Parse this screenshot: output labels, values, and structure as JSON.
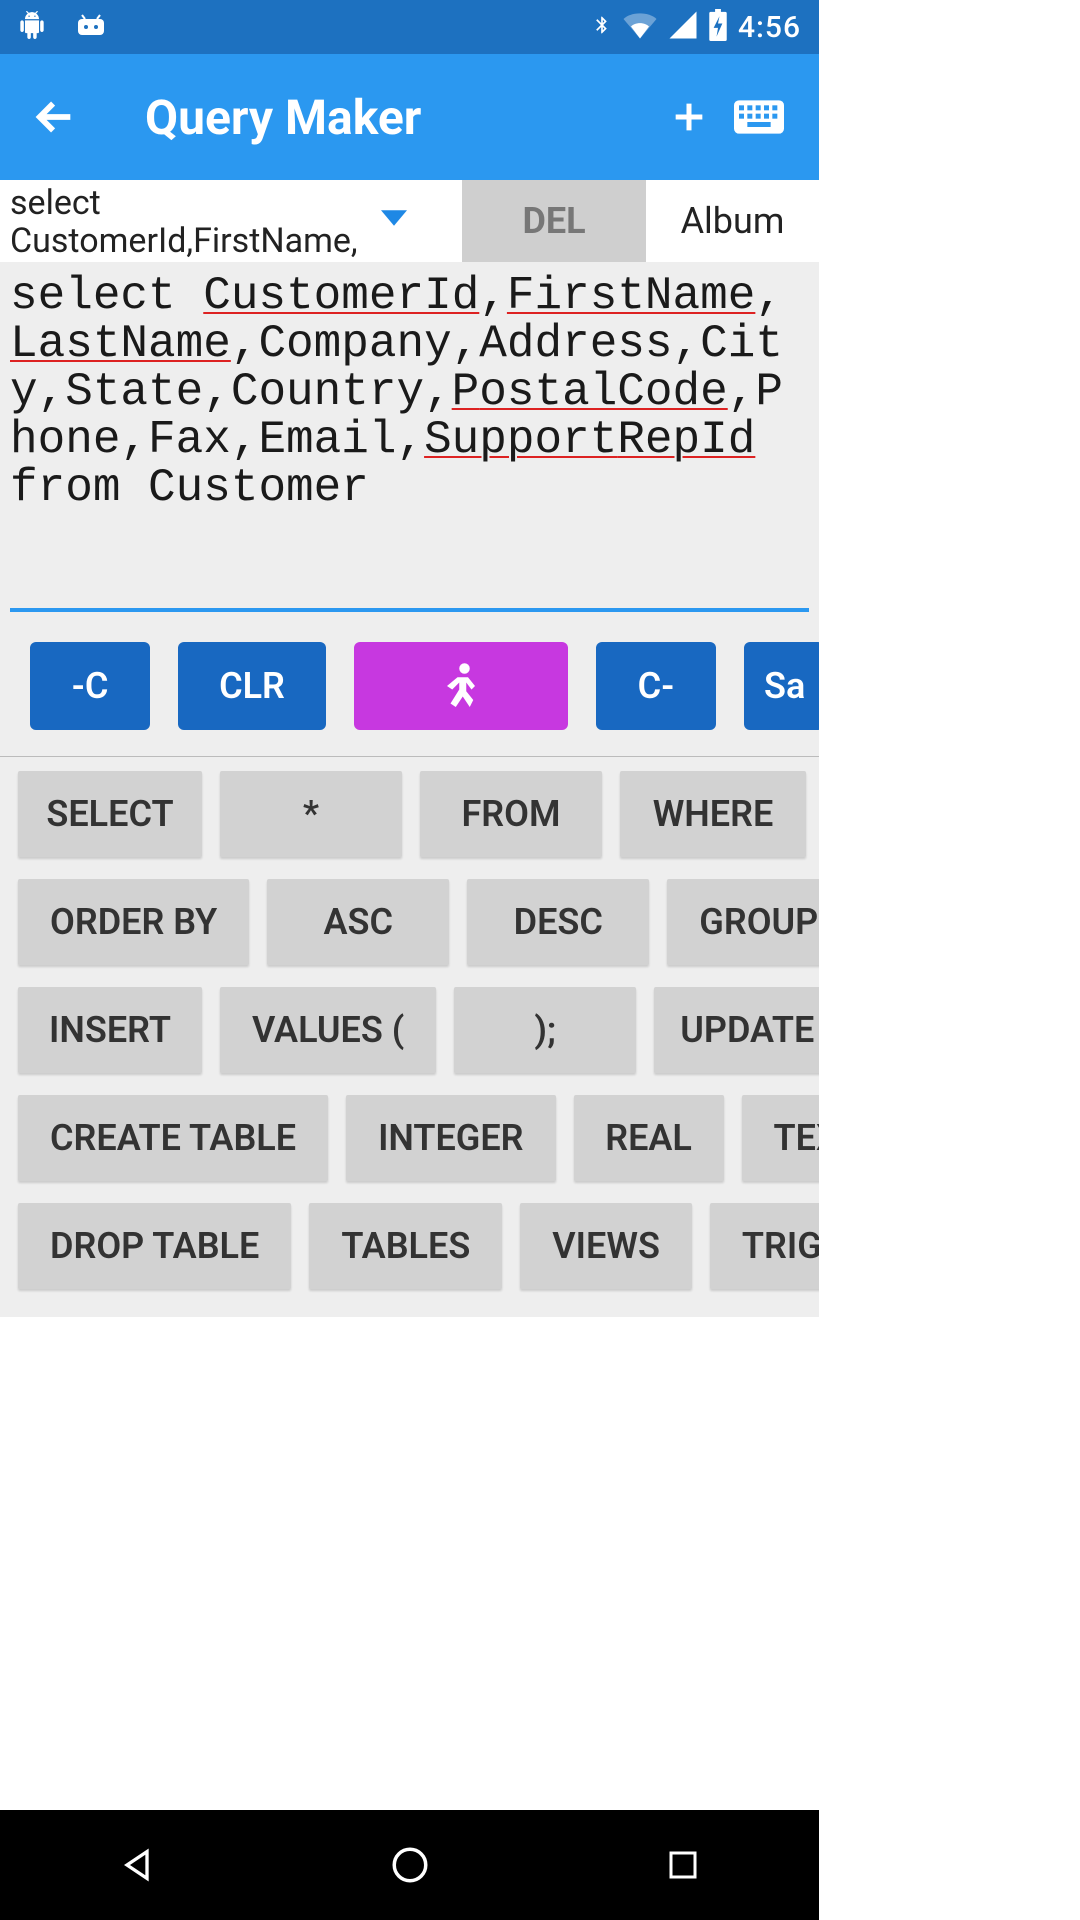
{
  "status": {
    "time": "4:56"
  },
  "appbar": {
    "title": "Query Maker"
  },
  "dropdown": {
    "text": "select CustomerId,FirstName,"
  },
  "del": {
    "label": "DEL"
  },
  "tabledd": {
    "label": "Album"
  },
  "editor": {
    "t0": "select",
    "w1": "CustomerId",
    "c1": ",",
    "w2": "FirstName",
    "c2": ",",
    "w3": "LastName",
    "c3": ",",
    "w4": "Com",
    "w5": "pany",
    "c5": ",Address,City,State,Country,",
    "w6": "P",
    "w7": "ostalCode",
    "c7": ",Phone,Fax,Email,",
    "w8": "Support",
    "w9": "RepId",
    "c9": " from Customer"
  },
  "actions": {
    "minus_c": "-C",
    "clr": "CLR",
    "c_minus": "C-",
    "save": "Sa"
  },
  "kw": {
    "r1": {
      "a": "SELECT",
      "b": "*",
      "c": "FROM",
      "d": "WHERE"
    },
    "r2": {
      "a": "ORDER BY",
      "b": "ASC",
      "c": "DESC",
      "d": "GROUP BY"
    },
    "r3": {
      "a": "INSERT",
      "b": "VALUES (",
      "c": ");",
      "d": "UPDATE"
    },
    "r4": {
      "a": "CREATE TABLE",
      "b": "INTEGER",
      "c": "REAL",
      "d": "TEXT"
    },
    "r5": {
      "a": "DROP TABLE",
      "b": "TABLES",
      "c": "VIEWS",
      "d": "TRIGGERS"
    }
  }
}
